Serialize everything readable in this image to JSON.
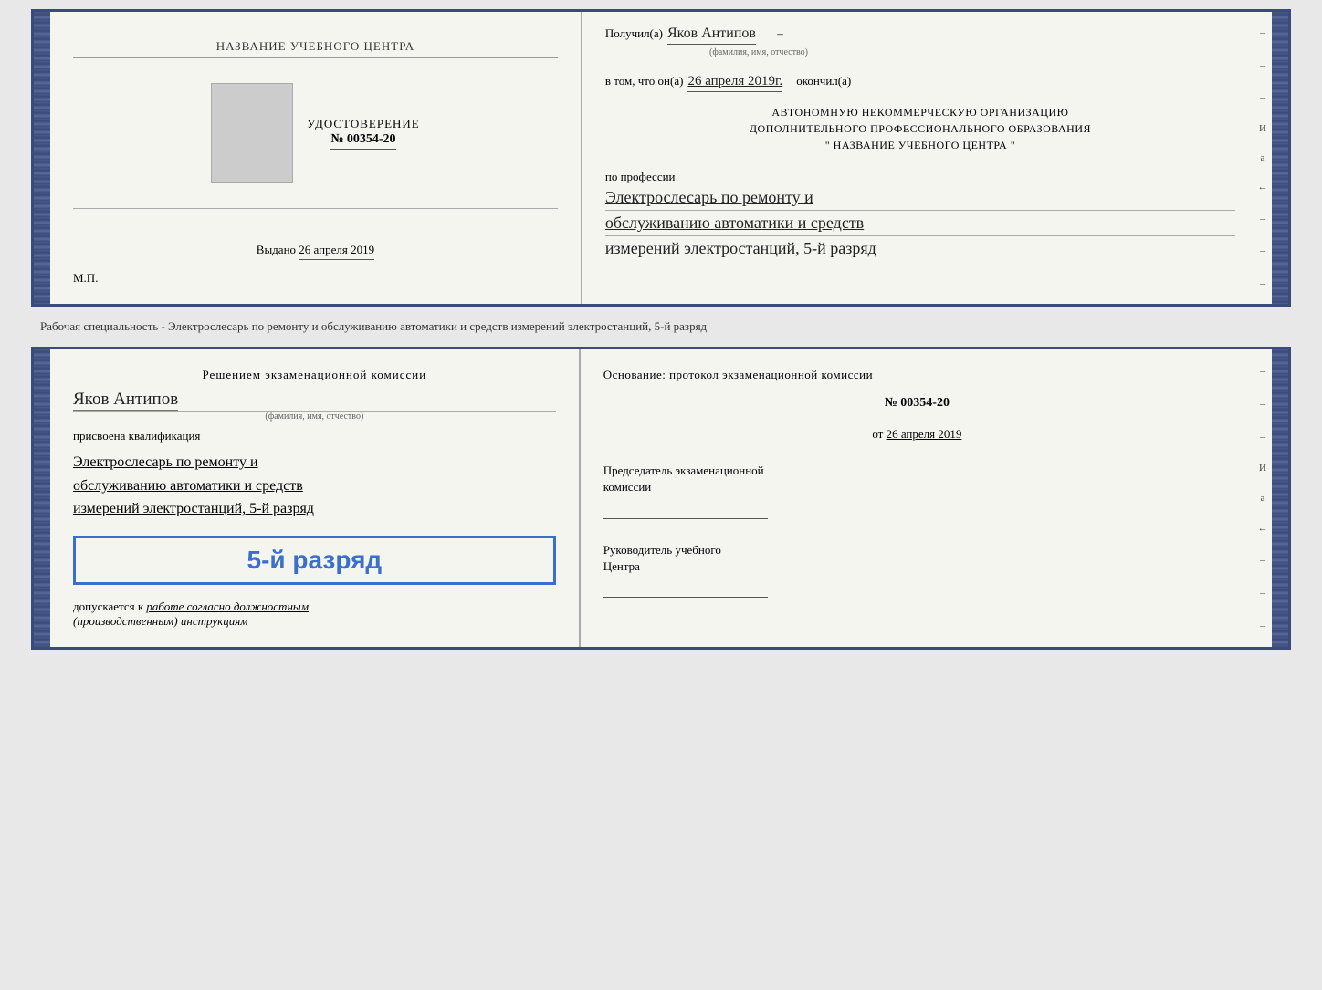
{
  "top_booklet": {
    "left": {
      "center_title": "НАЗВАНИЕ УЧЕБНОГО ЦЕНТРА",
      "cert_label": "УДОСТОВЕРЕНИЕ",
      "cert_number": "№ 00354-20",
      "issued_label": "Выдано",
      "issued_date": "26 апреля 2019",
      "mp_label": "М.П."
    },
    "right": {
      "received_label": "Получил(а)",
      "name_handwritten": "Яков Антипов",
      "fio_label": "(фамилия, имя, отчество)",
      "in_that_label": "в том, что он(а)",
      "date_handwritten": "26 апреля 2019г.",
      "finished_label": "окончил(а)",
      "org_line1": "АВТОНОМНУЮ НЕКОММЕРЧЕСКУЮ ОРГАНИЗАЦИЮ",
      "org_line2": "ДОПОЛНИТЕЛЬНОГО ПРОФЕССИОНАЛЬНОГО ОБРАЗОВАНИЯ",
      "org_line3": "\" НАЗВАНИЕ УЧЕБНОГО ЦЕНТРА \"",
      "profession_label": "по профессии",
      "profession_line1": "Электрослесарь по ремонту и",
      "profession_line2": "обслуживанию автоматики и средств",
      "profession_line3": "измерений электростанций, 5-й разряд"
    }
  },
  "middle_text": "Рабочая специальность - Электрослесарь по ремонту и обслуживанию автоматики и средств\nизмерений электростанций, 5-й разряд",
  "bottom_booklet": {
    "left": {
      "decision_label": "Решением экзаменационной комиссии",
      "name_handwritten": "Яков Антипов",
      "fio_label": "(фамилия, имя, отчество)",
      "assigned_label": "присвоена квалификация",
      "profession_line1": "Электрослесарь по ремонту и",
      "profession_line2": "обслуживанию автоматики и средств",
      "profession_line3": "измерений электростанций, 5-й разряд",
      "stamp_text": "5-й разряд",
      "допуск_label": "допускается к",
      "допуск_text": "работе согласно должностным",
      "допуск_text2": "(производственным) инструкциям"
    },
    "right": {
      "basis_label": "Основание: протокол экзаменационной комиссии",
      "protocol_number": "№ 00354-20",
      "from_label": "от",
      "from_date": "26 апреля 2019",
      "chairman_title_line1": "Председатель экзаменационной",
      "chairman_title_line2": "комиссии",
      "director_title_line1": "Руководитель учебного",
      "director_title_line2": "Центра"
    }
  },
  "side_marks": {
    "и": "И",
    "а": "а",
    "back": "←",
    "dashes": [
      "–",
      "–",
      "–",
      "–",
      "–",
      "–"
    ]
  }
}
